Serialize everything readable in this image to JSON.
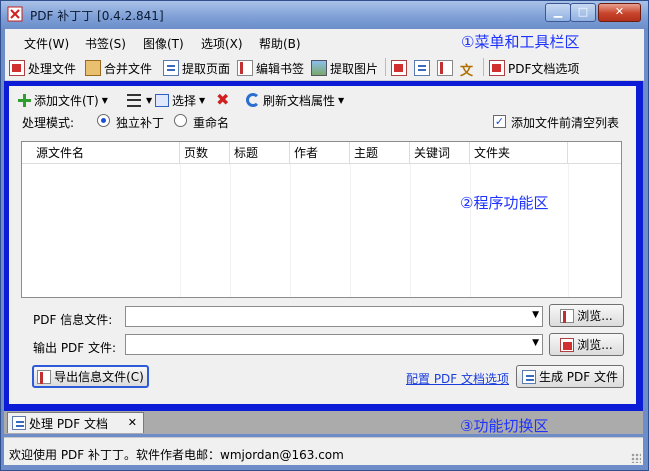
{
  "window": {
    "title": "PDF 补丁丁 [0.4.2.841]"
  },
  "menu": [
    "文件(W)",
    "书签(S)",
    "图像(T)",
    "选项(X)",
    "帮助(B)"
  ],
  "toolbar": {
    "process": "处理文件",
    "merge": "合并文件",
    "extract_pages": "提取页面",
    "edit_bookmarks": "编辑书签",
    "extract_images": "提取图片",
    "pdf_options": "PDF文档选项"
  },
  "annotations": {
    "menu_area": "①菜单和工具栏区",
    "function_area": "②程序功能区",
    "switch_area": "③功能切换区"
  },
  "panel_toolbar": {
    "add_files": "添加文件(T)",
    "select": "选择",
    "refresh_props": "刷新文档属性"
  },
  "mode": {
    "label": "处理模式:",
    "independent": "独立补丁",
    "rename": "重命名",
    "clear_list": "添加文件前清空列表"
  },
  "columns": [
    "源文件名",
    "页数",
    "标题",
    "作者",
    "主题",
    "关键词",
    "文件夹"
  ],
  "info_file": {
    "label": "PDF 信息文件:",
    "value": "",
    "browse": "浏览..."
  },
  "output_file": {
    "label": "输出 PDF 文件:",
    "value": "",
    "browse": "浏览..."
  },
  "buttons": {
    "export_info": "导出信息文件(C)",
    "config_link": "配置 PDF 文档选项",
    "generate": "生成 PDF 文件"
  },
  "tab": {
    "label": "处理 PDF 文档"
  },
  "status": "欢迎使用 PDF 补丁丁。软件作者电邮：wmjordan@163.com"
}
